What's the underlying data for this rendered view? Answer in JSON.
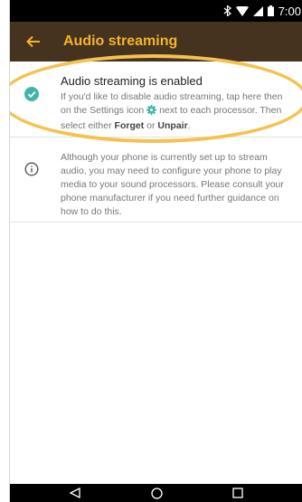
{
  "status_bar": {
    "time": "7:00",
    "icons": [
      "bluetooth-icon",
      "wifi-icon",
      "cellular-signal-icon",
      "battery-icon"
    ]
  },
  "app_bar": {
    "title": "Audio streaming",
    "back_icon": "arrow-left-icon"
  },
  "streaming_status": {
    "title": "Audio streaming is enabled",
    "body_1": "If you'd like to disable audio streaming, tap here then on the Settings icon",
    "body_2": "next to each processor. Then select either",
    "forget": "Forget",
    "or": "or",
    "unpair": "Unpair",
    "period": ".",
    "icon": "check-circle-icon",
    "inline_icon": "settings-gear-icon"
  },
  "info": {
    "body": "Although your phone is currently set up to stream audio, you may need to configure your phone to play media to your sound processors. Please consult your phone manufacturer if you need further guidance on how to do this.",
    "icon": "info-icon"
  },
  "nav_bar": {
    "icons": [
      "back-triangle-icon",
      "home-circle-icon",
      "recents-square-icon"
    ]
  },
  "colors": {
    "app_bar_bg": "#45321f",
    "title_accent": "#f3b52a",
    "check_teal": "#3fb5a8",
    "highlight": "#f4c24e"
  }
}
